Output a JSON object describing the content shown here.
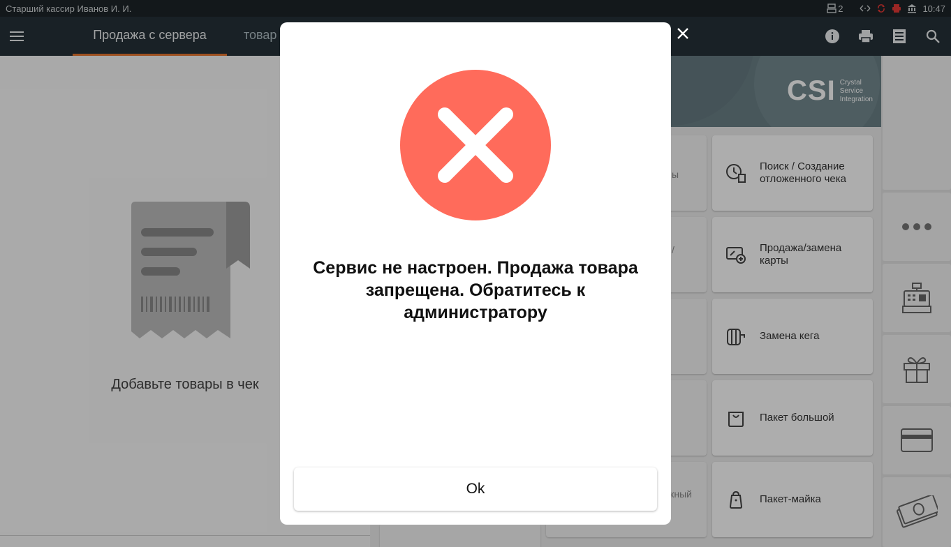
{
  "status_bar": {
    "user": "Старший кассир Иванов И. И.",
    "printer_count": "2",
    "time": "10:47"
  },
  "tabs": [
    {
      "label": "Продажа с сервера",
      "active": true
    },
    {
      "label": "товар",
      "active": false
    }
  ],
  "receipt": {
    "empty_text": "Добавьте товары в чек"
  },
  "banner": {
    "logo": "CSI",
    "tagline_1": "Crystal",
    "tagline_2": "Service",
    "tagline_3": "Integration"
  },
  "tiles": [
    {
      "label": "Поиск / Создание отложенного чека",
      "icon": "deferred-receipt-icon"
    },
    {
      "label": "Продажа/замена карты",
      "icon": "card-add-icon"
    },
    {
      "label": "Замена кега",
      "icon": "keg-icon"
    },
    {
      "label": "Пакет большой",
      "icon": "bag-icon"
    },
    {
      "label": "Пакет-майка",
      "icon": "tshirt-bag-icon"
    }
  ],
  "partial_tiles": [
    "ы",
    "/",
    "жный"
  ],
  "dialog": {
    "message": "Сервис не настроен. Продажа товара запрещена. Обратитесь к администратору",
    "ok_label": "Ok"
  },
  "colors": {
    "app_bar": "#263238",
    "tab_indicator": "#e8772e",
    "error": "#ff6b5b"
  }
}
